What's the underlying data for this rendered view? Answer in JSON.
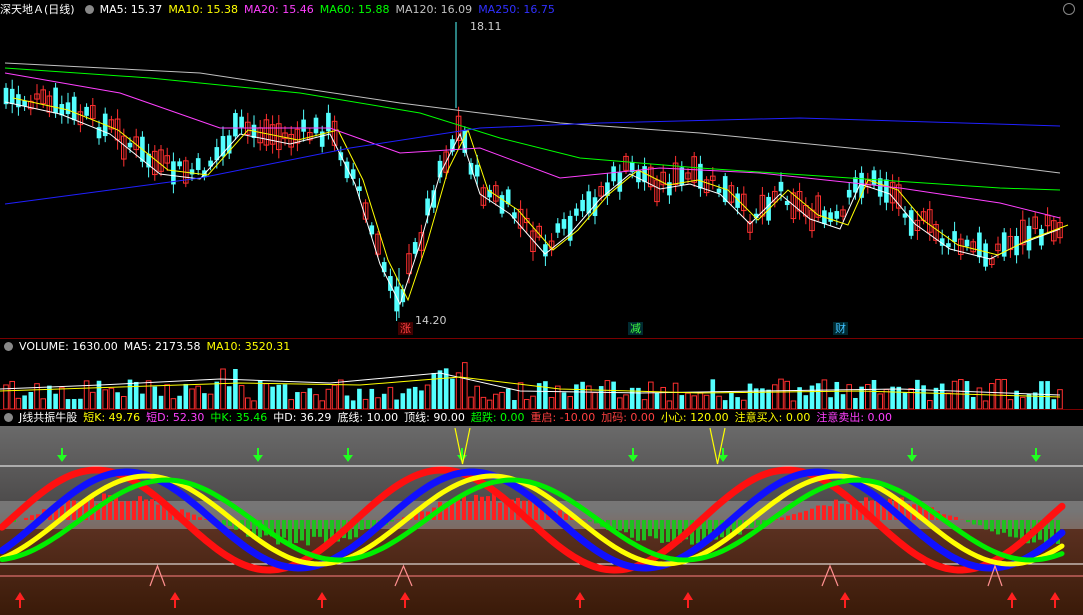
{
  "price_panel": {
    "title": "深天地Ａ(日线)",
    "ma": [
      {
        "label": "MA5: 15.37",
        "color": "#ffffff"
      },
      {
        "label": "MA10: 15.38",
        "color": "#ffff00"
      },
      {
        "label": "MA20: 15.46",
        "color": "#ff40ff"
      },
      {
        "label": "MA60: 15.88",
        "color": "#00ff00"
      },
      {
        "label": "MA120: 16.09",
        "color": "#c0c0c0"
      },
      {
        "label": "MA250: 16.75",
        "color": "#3030ff"
      }
    ],
    "high_label": "18.11",
    "low_label": "14.20",
    "markers": [
      {
        "text": "涨",
        "color": "#ff4040",
        "bg": "#400000"
      },
      {
        "text": "减",
        "color": "#40ff40",
        "bg": "#002a30"
      },
      {
        "text": "财",
        "color": "#40c0ff",
        "bg": "#002a30"
      }
    ]
  },
  "volume_panel": {
    "labels": [
      {
        "text": "VOLUME: 1630.00",
        "color": "#ffffff"
      },
      {
        "text": "MA5: 2173.58",
        "color": "#ffffff"
      },
      {
        "text": "MA10: 3520.31",
        "color": "#ffff00"
      }
    ]
  },
  "indicator_panel": {
    "title": "J线共振牛股",
    "labels": [
      {
        "text": "短K: 49.76",
        "color": "#ffff00"
      },
      {
        "text": "短D: 52.30",
        "color": "#ff40ff"
      },
      {
        "text": "中K: 35.46",
        "color": "#00ff00"
      },
      {
        "text": "中D: 36.29",
        "color": "#ffffff"
      },
      {
        "text": "底线: 10.00",
        "color": "#ffffff"
      },
      {
        "text": "顶线: 90.00",
        "color": "#ffffff"
      },
      {
        "text": "超跌: 0.00",
        "color": "#00ff00"
      },
      {
        "text": "重启: -10.00",
        "color": "#ff4040"
      },
      {
        "text": "加码: 0.00",
        "color": "#ff4040"
      },
      {
        "text": "小心: 120.00",
        "color": "#ffff00"
      },
      {
        "text": "注意买入: 0.00",
        "color": "#ffff00"
      },
      {
        "text": "注意卖出: 0.00",
        "color": "#ff40ff"
      }
    ]
  },
  "toolbar": {
    "settings_icon": "gear-icon",
    "collapse_icon": "chevron-down-icon"
  }
}
